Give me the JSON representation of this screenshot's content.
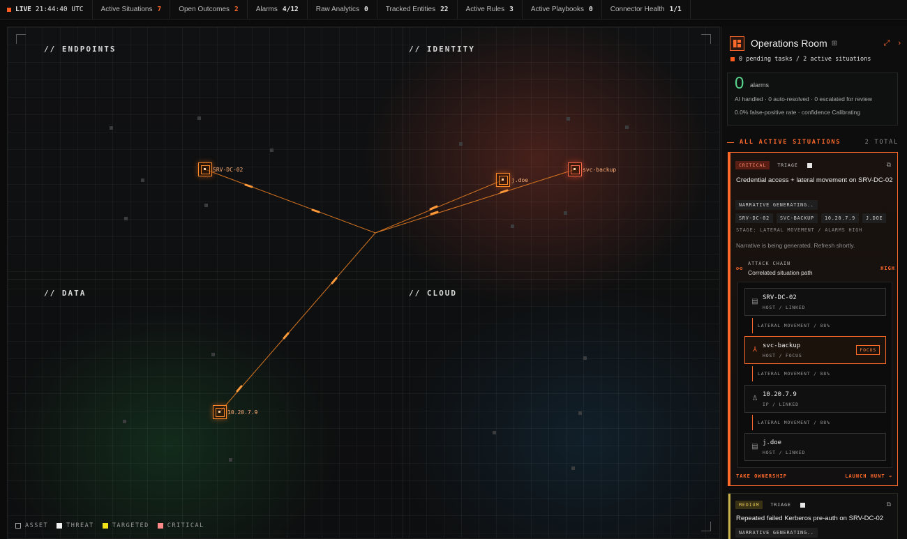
{
  "topbar": {
    "live_label": "LIVE",
    "clock": "21:44:40 UTC",
    "stats": [
      {
        "label": "Active Situations",
        "value": "7",
        "accent": true
      },
      {
        "label": "Open Outcomes",
        "value": "2",
        "accent": true
      },
      {
        "label": "Alarms",
        "value": "4/12",
        "accent": false
      },
      {
        "label": "Raw Analytics",
        "value": "0",
        "accent": false
      },
      {
        "label": "Tracked Entities",
        "value": "22",
        "accent": false
      },
      {
        "label": "Active Rules",
        "value": "3",
        "accent": false
      },
      {
        "label": "Active Playbooks",
        "value": "0",
        "accent": false
      },
      {
        "label": "Connector Health",
        "value": "1/1",
        "accent": false
      }
    ]
  },
  "map": {
    "quadrants": [
      "// ENDPOINTS",
      "// IDENTITY",
      "// DATA",
      "// CLOUD"
    ],
    "nodes": [
      {
        "label": "SRV-DC-02"
      },
      {
        "label": "j.doe"
      },
      {
        "label": "svc-backup"
      },
      {
        "label": "10.20.7.9"
      }
    ],
    "legend": [
      {
        "label": "ASSET",
        "color": "#0d0d0d"
      },
      {
        "label": "THREAT",
        "color": "#f2f2f2"
      },
      {
        "label": "TARGETED",
        "color": "#f2e21a"
      },
      {
        "label": "CRITICAL",
        "color": "#ff8a8a"
      }
    ]
  },
  "panel": {
    "title": "Operations Room",
    "subline": "0 pending tasks / 2 active situations",
    "alarms": {
      "count": "0",
      "label": "alarms",
      "line1": "AI handled · 0 auto-resolved · 0 escalated for review",
      "line2": "0.0% false-positive rate · confidence Calibrating"
    },
    "section_title": "ALL ACTIVE SITUATIONS",
    "section_count": "2 TOTAL",
    "situations": [
      {
        "severity": "CRITICAL",
        "state": "TRIAGE",
        "title": "Credential access + lateral movement on SRV-DC-02",
        "status_chip": "NARRATIVE GENERATING..",
        "entities": [
          "SRV-DC-02",
          "SVC-BACKUP",
          "10.20.7.9",
          "J.DOE"
        ],
        "meta": "STAGE: LATERAL MOVEMENT  / ALARMS  HIGH",
        "narrative": "Narrative is being generated. Refresh shortly.",
        "chain_label": "ATTACK CHAIN",
        "chain_desc": "Correlated situation path",
        "chain_level": "HIGH",
        "hops": [
          {
            "name": "SRV-DC-02",
            "sub": "HOST / LINKED",
            "icon": "server-icon"
          },
          {
            "name": "svc-backup",
            "sub": "HOST / FOCUS",
            "icon": "network-icon",
            "tag": "FOCUS"
          },
          {
            "name": "10.20.7.9",
            "sub": "IP / LINKED",
            "icon": "user-icon"
          },
          {
            "name": "j.doe",
            "sub": "HOST / LINKED",
            "icon": "server-icon"
          }
        ],
        "edges": [
          "LATERAL MOVEMENT / 88%",
          "LATERAL MOVEMENT / 88%",
          "LATERAL MOVEMENT / 88%"
        ],
        "action_left": "TAKE OWNERSHIP",
        "action_right": "LAUNCH HUNT →"
      },
      {
        "severity": "MEDIUM",
        "state": "TRIAGE",
        "title": "Repeated failed Kerberos pre-auth on SRV-DC-02",
        "status_chip": "NARRATIVE GENERATING.."
      }
    ]
  }
}
